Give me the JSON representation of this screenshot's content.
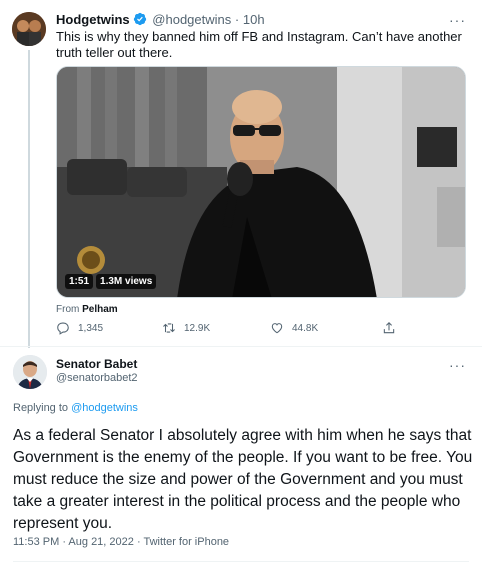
{
  "quoted_tweet": {
    "author_name": "Hodgetwins",
    "author_handle": "@hodgetwins",
    "separator": "·",
    "time": "10h",
    "text": "This is why they banned him off FB and Instagram. Can’t have another truth teller out there.",
    "media": {
      "duration": "1:51",
      "views": "1.3M views"
    },
    "from_label": "From",
    "from_source": "Pelham",
    "stats": {
      "replies": "1,345",
      "retweets": "12.9K",
      "likes": "44.8K"
    }
  },
  "main_tweet": {
    "author_name": "Senator Babet",
    "author_handle": "@senatorbabet2",
    "replying_label": "Replying to",
    "replying_to": "@hodgetwins",
    "text": "As a federal Senator I absolutely agree with him when he says that Government is the enemy of the people. If you want to be free. You must reduce the size and power of the Government and you must take a greater interest in the political process and the people who represent you.",
    "meta": "11:53 PM · Aug 21, 2022 · Twitter for iPhone"
  },
  "colors": {
    "accent": "#1d9bf0",
    "text_primary": "#0f1419",
    "text_secondary": "#536471",
    "divider": "#eff3f4"
  },
  "icons": [
    "verified-badge-icon",
    "more-icon",
    "reply-icon",
    "retweet-icon",
    "like-icon",
    "share-icon"
  ]
}
